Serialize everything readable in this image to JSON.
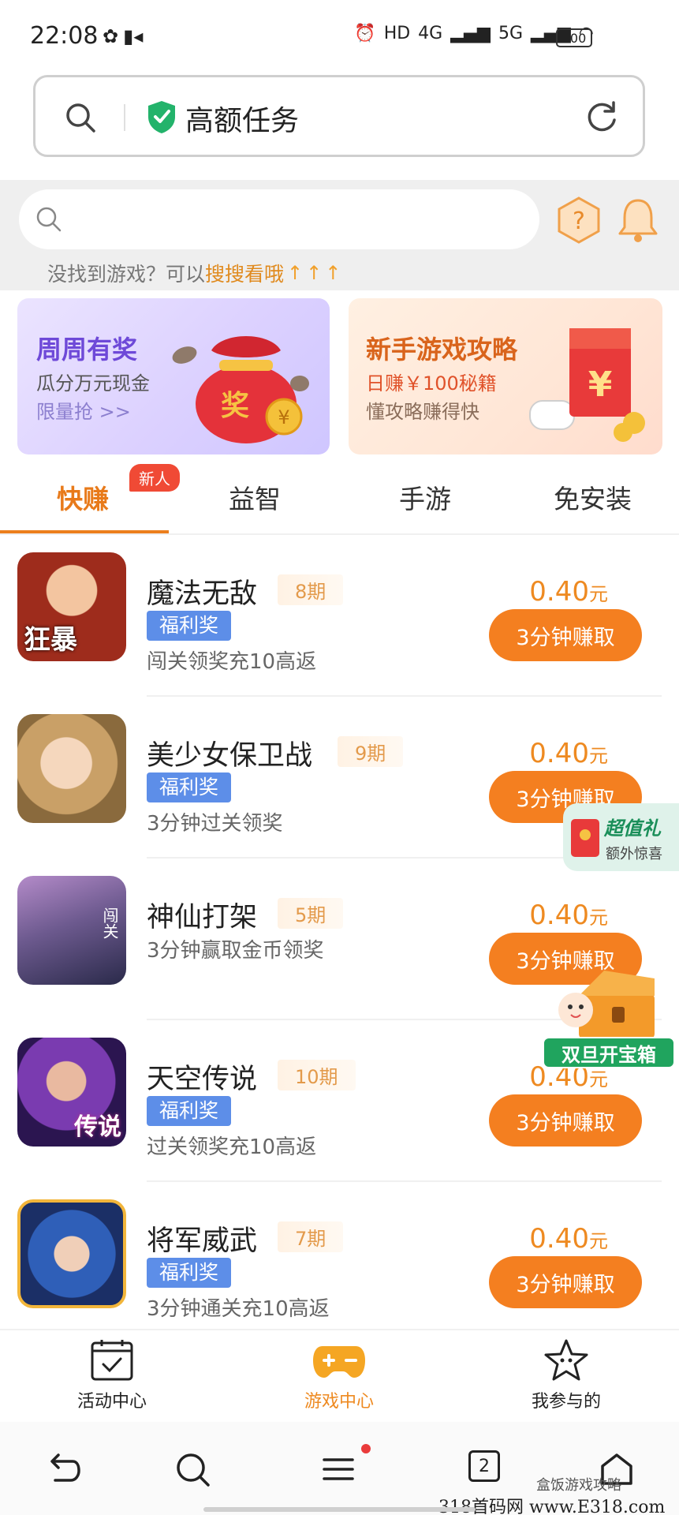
{
  "status_bar": {
    "time": "22:08",
    "network_labels": [
      "HD",
      "4G",
      "5G"
    ],
    "battery": "100"
  },
  "url_bar": {
    "title": "高额任务"
  },
  "search": {
    "hint_prefix": "没找到游戏？可以",
    "hint_link": "搜搜看哦"
  },
  "banners": [
    {
      "title": "周周有奖",
      "subtitle": "瓜分万元现金",
      "action": "限量抢 >>",
      "bag_label": "奖",
      "coin_label": "¥"
    },
    {
      "title": "新手游戏攻略",
      "subtitle": "日赚￥100秘籍",
      "action": "懂攻略赚得快",
      "envelope_label": "¥"
    }
  ],
  "tabs": [
    {
      "label": "快赚",
      "badge": "新人",
      "active": true
    },
    {
      "label": "益智"
    },
    {
      "label": "手游"
    },
    {
      "label": "免安装"
    }
  ],
  "games": [
    {
      "name": "魔法无敌",
      "period": "8期",
      "tag": "福利奖",
      "desc": "闯关领奖充10高返",
      "price": "0.40",
      "unit": "元",
      "button": "3分钟赚取",
      "icon_text": "狂暴",
      "icon_color": "#a4311f"
    },
    {
      "name": "美少女保卫战",
      "period": "9期",
      "tag": "福利奖",
      "desc": "3分钟过关领奖",
      "price": "0.40",
      "unit": "元",
      "button": "3分钟赚取",
      "icon_text": "",
      "icon_color": "#d7b07a"
    },
    {
      "name": "神仙打架",
      "period": "5期",
      "tag": "",
      "desc": "3分钟赢取金币领奖",
      "price": "0.40",
      "unit": "元",
      "button": "3分钟赚取",
      "icon_text": "闯关",
      "icon_color": "#6d5a8f"
    },
    {
      "name": "天空传说",
      "period": "10期",
      "tag": "福利奖",
      "desc": "过关领奖充10高返",
      "price": "0.40",
      "unit": "元",
      "button": "3分钟赚取",
      "icon_text": "传说",
      "icon_color": "#5a2c8a"
    },
    {
      "name": "将军威武",
      "period": "7期",
      "tag": "福利奖",
      "desc": "3分钟通关充10高返",
      "price": "0.40",
      "unit": "元",
      "button": "3分钟赚取",
      "icon_text": "",
      "icon_color": "#2f5fb8"
    }
  ],
  "float_widgets": {
    "gift_title": "超值礼",
    "gift_sub": "额外惊喜",
    "chest_label": "双旦开宝箱"
  },
  "app_nav": [
    {
      "label": "活动中心"
    },
    {
      "label": "游戏中心",
      "active": true
    },
    {
      "label": "我参与的"
    }
  ],
  "system_nav": {
    "tab_count": "2"
  },
  "watermark": "盒饭游戏攻略",
  "footer_mark": "318首码网 www.E318.com"
}
